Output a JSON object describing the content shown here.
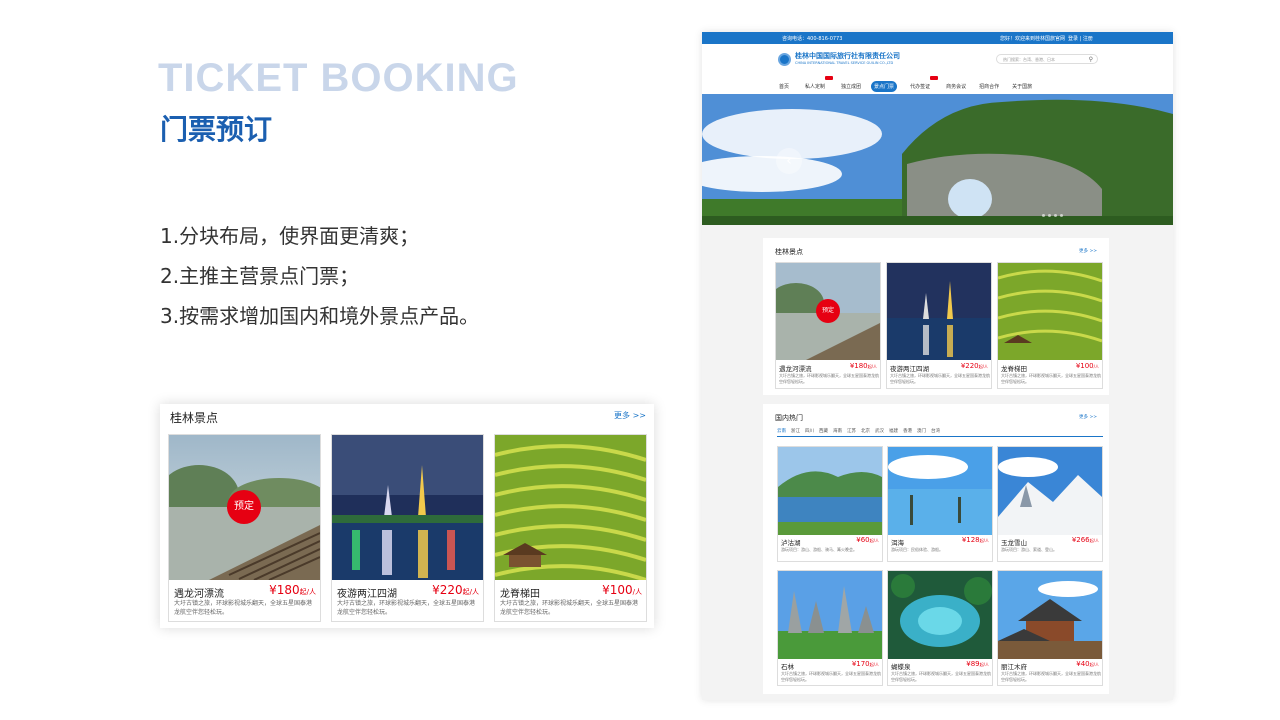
{
  "intro": {
    "title_en": "TICKET BOOKING",
    "title_cn": "门票预订",
    "points": [
      "1.分块布局，使界面更清爽；",
      "2.主推主营景点门票；",
      "3.按需求增加国内和境外景点产品。"
    ]
  },
  "zoom_card": {
    "heading": "桂林景点",
    "more": "更多 >>",
    "badge": "预定",
    "items": [
      {
        "name": "遇龙河漂流",
        "price": "¥180",
        "unit": "起/人",
        "desc": "大圩古镇之旅，环球影视城乐翻天，全球五星国泰港龙航空伴您轻松玩。"
      },
      {
        "name": "夜游两江四湖",
        "price": "¥220",
        "unit": "起/人",
        "desc": "大圩古镇之旅，环球影视城乐翻天，全球五星国泰港龙航空伴您轻松玩。"
      },
      {
        "name": "龙脊梯田",
        "price": "¥100",
        "unit": "/人",
        "desc": "大圩古镇之旅，环球影视城乐翻天，全球五星国泰港龙航空伴您轻松玩。"
      }
    ]
  },
  "site": {
    "topbar": {
      "phone": "咨询电话：400-816-0773",
      "welcome": "您好！欢迎来到桂林国旅官网",
      "login": "登录 | 注册"
    },
    "logo": {
      "cn": "桂林中国国际旅行社有限责任公司",
      "en": "CHINA INTERNATIONAL TRAVEL SERVICE GUILIN CO.,LTD"
    },
    "search_placeholder": "热门搜索：台湾、香港、日本",
    "nav": [
      "首页",
      "私人定制",
      "独立成团",
      "景点门票",
      "代办签证",
      "商务会议",
      "招商合作",
      "关于国旅"
    ],
    "nav_active_index": 3,
    "guilin": {
      "title": "桂林景点",
      "more": "更多 >>",
      "badge": "预定",
      "items": [
        {
          "name": "遇龙河漂流",
          "price": "¥180",
          "unit": "起/人",
          "desc": "大圩古镇之旅，环球影视城乐翻天，全球五星国泰港龙航空伴您轻松玩。"
        },
        {
          "name": "夜游两江四湖",
          "price": "¥220",
          "unit": "起/人",
          "desc": "大圩古镇之旅，环球影视城乐翻天，全球五星国泰港龙航空伴您轻松玩。"
        },
        {
          "name": "龙脊梯田",
          "price": "¥100",
          "unit": "/人",
          "desc": "大圩古镇之旅，环球影视城乐翻天，全球五星国泰港龙航空伴您轻松玩。"
        }
      ]
    },
    "domestic": {
      "title": "国内热门",
      "more": "更多 >>",
      "tabs": [
        "云南",
        "浙江",
        "四川",
        "西藏",
        "海南",
        "江苏",
        "北京",
        "武汉",
        "福建",
        "香港",
        "澳门",
        "台湾"
      ],
      "items": [
        {
          "name": "泸沽湖",
          "price": "¥60",
          "unit": "起/人",
          "desc": "游玩项目：游山、游船、骑马、篝火晚会。"
        },
        {
          "name": "洱海",
          "price": "¥128",
          "unit": "起/人",
          "desc": "游玩项目：民俗体验、游船。"
        },
        {
          "name": "玉龙雪山",
          "price": "¥266",
          "unit": "起/人",
          "desc": "游玩项目：游山、索道、登山。"
        },
        {
          "name": "石林",
          "price": "¥170",
          "unit": "起/人",
          "desc": "大圩古镇之旅，环球影视城乐翻天，全球五星国泰港龙航空伴您轻松玩。"
        },
        {
          "name": "蝴蝶泉",
          "price": "¥89",
          "unit": "起/人",
          "desc": "大圩古镇之旅，环球影视城乐翻天，全球五星国泰港龙航空伴您轻松玩。"
        },
        {
          "name": "丽江木府",
          "price": "¥40",
          "unit": "起/人",
          "desc": "大圩古镇之旅，环球影视城乐翻天，全球五星国泰港龙航空伴您轻松玩。"
        }
      ]
    }
  }
}
